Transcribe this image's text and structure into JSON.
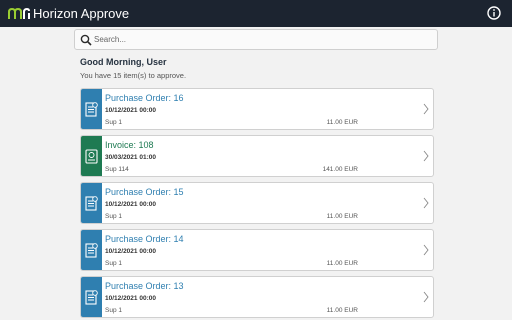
{
  "header": {
    "app_title": "Horizon Approve",
    "logo_icon": "horizon-logo-icon",
    "info_icon": "info-icon",
    "background": "#1c2430"
  },
  "search": {
    "placeholder": "Search...",
    "value": ""
  },
  "greeting": {
    "title": "Good Morning, User",
    "subtitle": "You have 15 item(s) to approve."
  },
  "colors": {
    "purchase_order": "#2f7fb0",
    "invoice": "#1e7a52"
  },
  "items": [
    {
      "type": "purchase_order",
      "title": "Purchase Order: 16",
      "date": "10/12/2021 00:00",
      "supplier": "Sup 1",
      "amount": "11.00 EUR"
    },
    {
      "type": "invoice",
      "title": "Invoice: 108",
      "date": "30/03/2021 01:00",
      "supplier": "Sup 114",
      "amount": "141.00 EUR"
    },
    {
      "type": "purchase_order",
      "title": "Purchase Order: 15",
      "date": "10/12/2021 00:00",
      "supplier": "Sup 1",
      "amount": "11.00 EUR"
    },
    {
      "type": "purchase_order",
      "title": "Purchase Order: 14",
      "date": "10/12/2021 00:00",
      "supplier": "Sup 1",
      "amount": "11.00 EUR"
    },
    {
      "type": "purchase_order",
      "title": "Purchase Order: 13",
      "date": "10/12/2021 00:00",
      "supplier": "Sup 1",
      "amount": "11.00 EUR"
    }
  ]
}
